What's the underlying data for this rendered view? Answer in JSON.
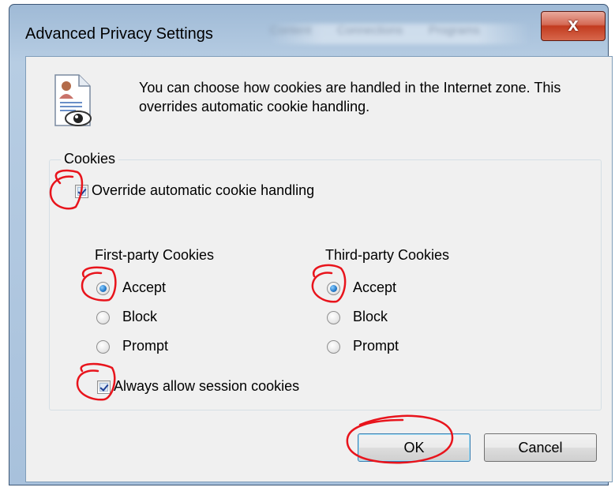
{
  "window": {
    "title": "Advanced Privacy Settings",
    "close_label": "x",
    "background_tabs": [
      "Content",
      "Connections",
      "Programs"
    ]
  },
  "intro_text": "You can choose how cookies are handled in the Internet zone.  This overrides automatic cookie handling.",
  "cookies": {
    "group_label": "Cookies",
    "override_label": "Override automatic cookie handling",
    "override_checked": true,
    "first_party": {
      "heading": "First-party Cookies",
      "options": [
        "Accept",
        "Block",
        "Prompt"
      ],
      "selected": "Accept"
    },
    "third_party": {
      "heading": "Third-party Cookies",
      "options": [
        "Accept",
        "Block",
        "Prompt"
      ],
      "selected": "Accept"
    },
    "session_label": "Always allow session cookies",
    "session_checked": true
  },
  "buttons": {
    "ok": "OK",
    "cancel": "Cancel"
  },
  "colors": {
    "annotation": "#e8141c",
    "title_bar": "#b7cde3",
    "client": "#f0f0f0"
  },
  "icons": [
    "privacy-document-icon",
    "close-icon"
  ]
}
